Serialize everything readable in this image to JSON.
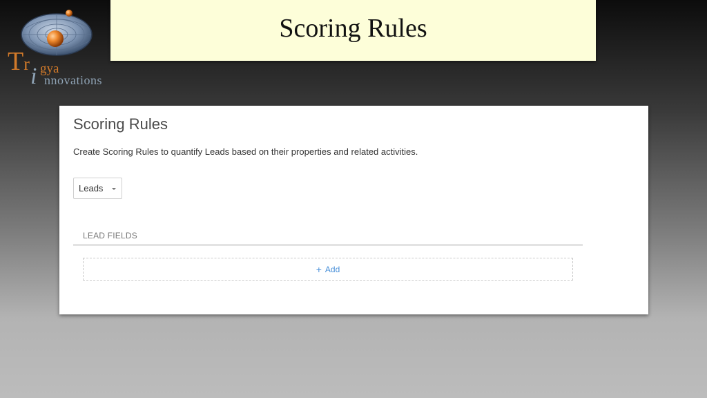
{
  "logo": {
    "letter_t": "T",
    "letter_r": "r",
    "gya": "gya",
    "letter_i": "i",
    "innovations": "nnovations"
  },
  "slide": {
    "title": "Scoring Rules"
  },
  "panel": {
    "heading": "Scoring Rules",
    "description": "Create Scoring Rules to quantify Leads based on their properties and related activities.",
    "object_select": {
      "selected": "Leads"
    },
    "section_label": "LEAD FIELDS",
    "add_label": "Add",
    "add_icon": "plus-icon"
  },
  "colors": {
    "title_box_bg": "#fdfed9",
    "brand_orange": "#d27a2a",
    "brand_steel": "#8fa3b5",
    "link_blue": "#4a90d9"
  }
}
